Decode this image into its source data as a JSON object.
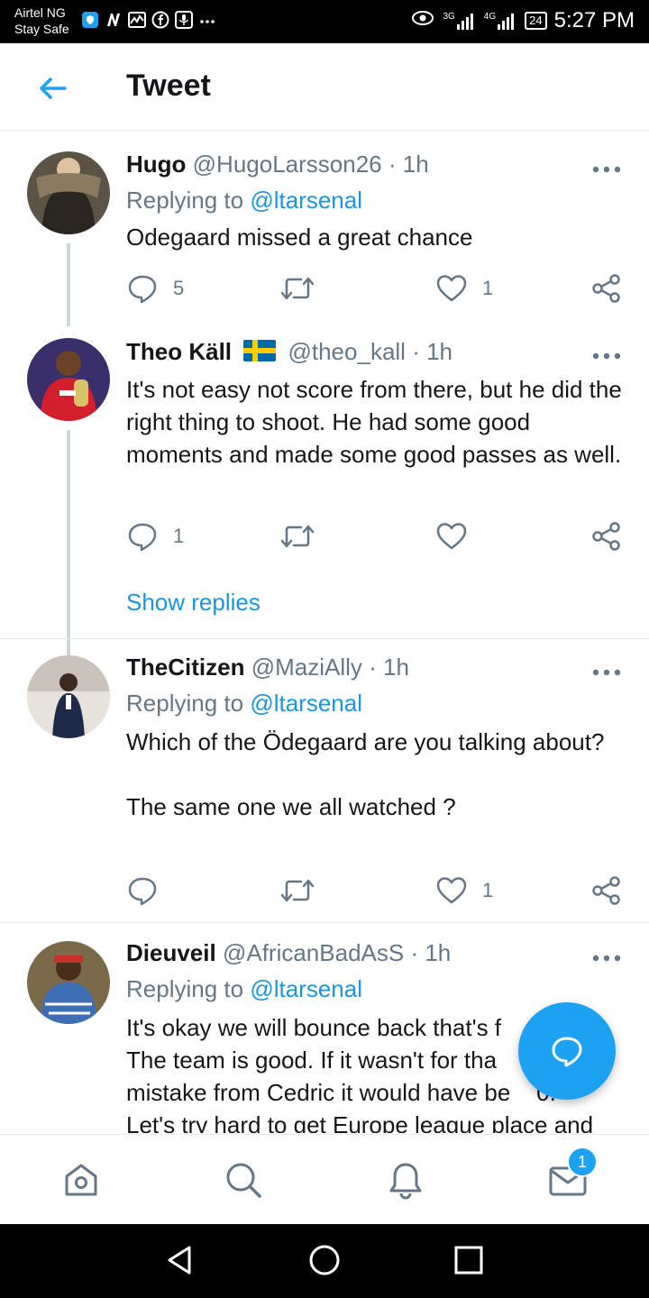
{
  "status_bar": {
    "carrier_line1": "Airtel NG",
    "carrier_line2": "Stay Safe",
    "signal_3g": "3G",
    "signal_4g": "4G",
    "battery": "24",
    "time": "5:27 PM"
  },
  "header": {
    "title": "Tweet"
  },
  "tweets": [
    {
      "name": "Hugo",
      "handle": "@HugoLarsson26",
      "time": "· 1h",
      "replying_prefix": "Replying to",
      "replying_to": "@ltarsenal",
      "text": "Odegaard missed a great chance",
      "reply_count": "5",
      "retweet_count": "",
      "like_count": "1"
    },
    {
      "name": "Theo Käll",
      "handle": "@theo_kall",
      "time": "· 1h",
      "text": "It's not easy not score from there, but he did the right thing to shoot. He had some good moments and made some good passes as well.",
      "reply_count": "1",
      "retweet_count": "",
      "like_count": ""
    },
    {
      "name": "TheCitizen",
      "handle": "@MaziAlly",
      "time": "· 1h",
      "replying_prefix": "Replying to",
      "replying_to": "@ltarsenal",
      "text": "Which of the Ödegaard are you talking about?\n\nThe same one we all watched ?",
      "reply_count": "",
      "retweet_count": "",
      "like_count": "1"
    },
    {
      "name": "Dieuveil",
      "handle": "@AfricanBadAsS",
      "time": "· 1h",
      "replying_prefix": "Replying to",
      "replying_to": "@ltarsenal",
      "text": "It's okay we will bounce back that's f\nThe team is good. If it wasn't for tha\nmistake from Cedric it would have be    0.\nLet's try hard to get Europe league place and"
    }
  ],
  "show_replies": "Show replies",
  "notifications_badge": "1",
  "colors": {
    "accent": "#1da1f2",
    "link": "#1b95e0",
    "muted": "#657786",
    "text": "#14171a"
  },
  "icons": {
    "back": "arrow-left-icon",
    "more": "more-horizontal-icon",
    "reply": "speech-bubble-icon",
    "retweet": "retweet-icon",
    "like": "heart-icon",
    "share": "share-icon",
    "home": "home-icon",
    "search": "search-icon",
    "notifications": "bell-icon",
    "messages": "mail-icon",
    "compose": "compose-reply-icon",
    "flag": "sweden-flag-icon"
  }
}
